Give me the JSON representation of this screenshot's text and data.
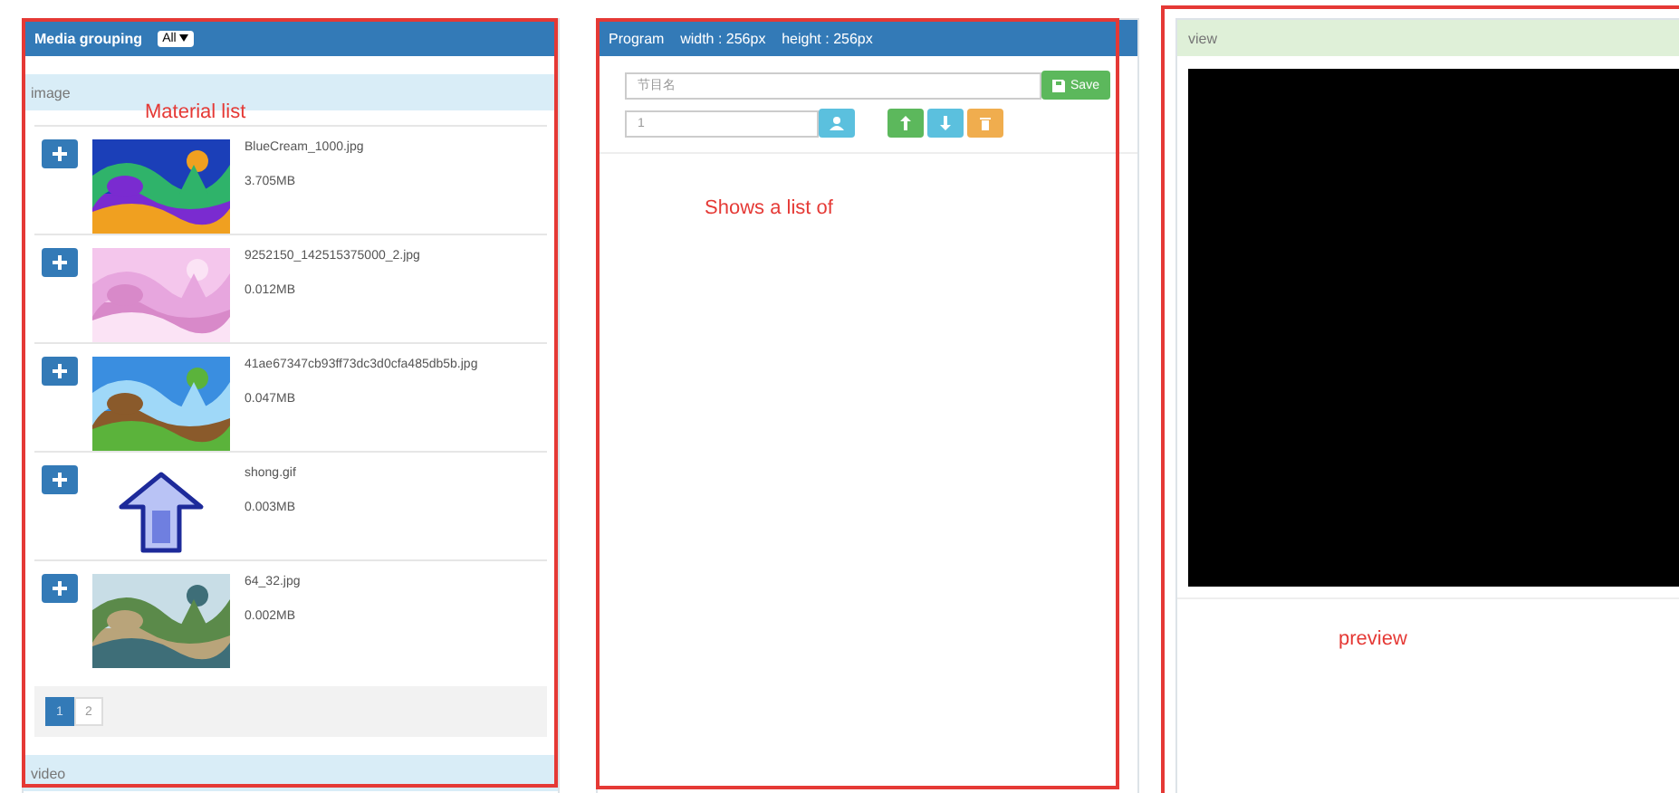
{
  "media_panel": {
    "title": "Media grouping",
    "group_select": {
      "value": "All"
    },
    "sections": [
      {
        "title": "image",
        "items": [
          {
            "name": "BlueCream_1000.jpg",
            "size": "3.705MB"
          },
          {
            "name": "9252150_142515375000_2.jpg",
            "size": "0.012MB"
          },
          {
            "name": "41ae67347cb93ff73dc3d0cfa485db5b.jpg",
            "size": "0.047MB"
          },
          {
            "name": "shong.gif",
            "size": "0.003MB",
            "kind": "arrow"
          },
          {
            "name": "64_32.jpg",
            "size": "0.002MB"
          }
        ],
        "pages": [
          {
            "label": "1",
            "selected": true
          },
          {
            "label": "2",
            "selected": false
          }
        ]
      },
      {
        "title": "video"
      }
    ]
  },
  "program_panel": {
    "title": "Program    width : 256px    height : 256px",
    "name_field": {
      "placeholder": "节目名"
    },
    "save_button": "Save",
    "number_field": {
      "value": "1"
    }
  },
  "view_panel": {
    "title": "view"
  },
  "annotations": [
    {
      "label": "Material list"
    },
    {
      "label": "Shows a list of"
    },
    {
      "label": "preview"
    }
  ]
}
